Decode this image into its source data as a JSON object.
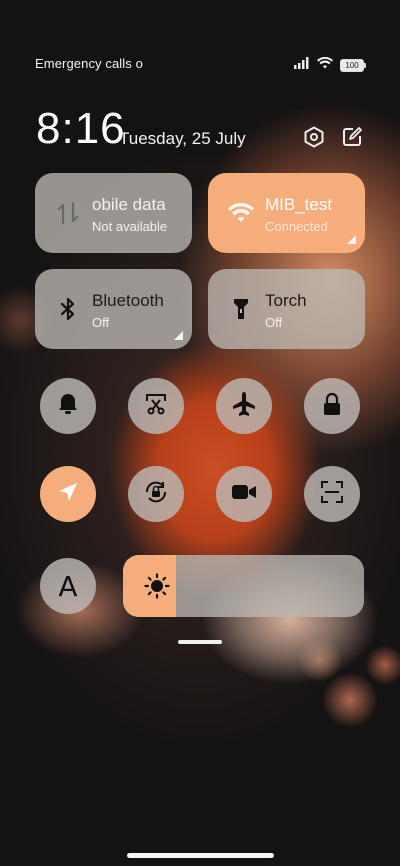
{
  "status_bar": {
    "left_text": "Emergency calls o",
    "icons": [
      "signal-icon",
      "wifi-icon",
      "battery-icon"
    ],
    "battery_label": "100"
  },
  "header": {
    "time": "8:16",
    "date": "Tuesday, 25 July",
    "icons": [
      "settings-icon",
      "edit-icon"
    ]
  },
  "tiles": [
    {
      "title": "obile data",
      "subtitle": "Not available",
      "icon": "mobile-data-icon",
      "state": "off"
    },
    {
      "title": "MIB_test",
      "subtitle": "Connected",
      "icon": "wifi-icon",
      "state": "on"
    },
    {
      "title": "Bluetooth",
      "subtitle": "Off",
      "icon": "bluetooth-icon",
      "state": "off"
    },
    {
      "title": "Torch",
      "subtitle": "Off",
      "icon": "torch-icon",
      "state": "off"
    }
  ],
  "toggles": [
    {
      "name": "bell-icon",
      "state": "off"
    },
    {
      "name": "screenshot-icon",
      "state": "off"
    },
    {
      "name": "airplane-icon",
      "state": "off"
    },
    {
      "name": "lock-icon",
      "state": "off"
    },
    {
      "name": "location-icon",
      "state": "on"
    },
    {
      "name": "auto-rotate-icon",
      "state": "off"
    },
    {
      "name": "video-camera-icon",
      "state": "off"
    },
    {
      "name": "scanner-icon",
      "state": "off"
    }
  ],
  "font_toggle": {
    "label": "A"
  },
  "brightness": {
    "level": 0.22,
    "icon": "sun-icon"
  },
  "colors": {
    "accent": "#f5ad7c",
    "tile_bg": "#bcb8b4"
  }
}
